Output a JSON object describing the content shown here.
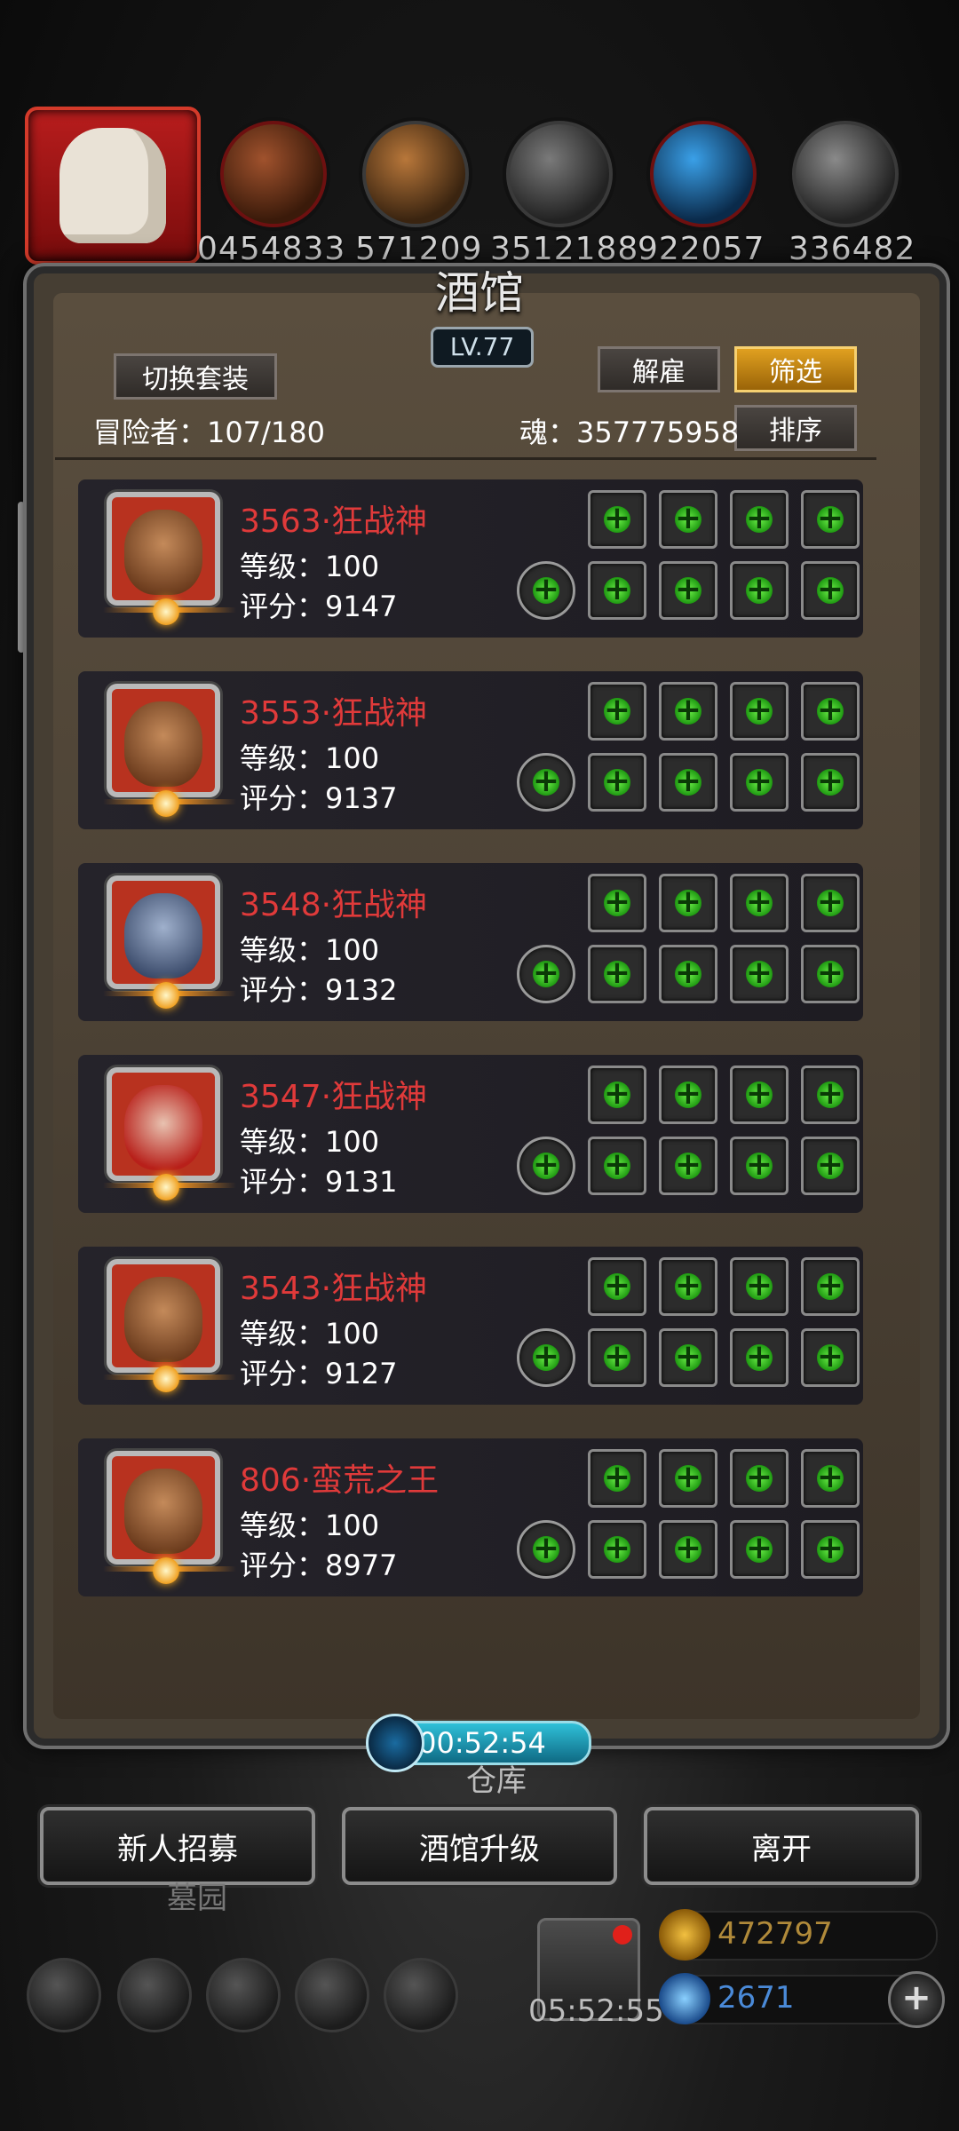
{
  "top_bar": {
    "resources": [
      "0454833",
      "571209",
      "3512188",
      "922057",
      "336482"
    ]
  },
  "tavern": {
    "title": "酒馆",
    "level": "LV.77",
    "switch_set_label": "切换套装",
    "dismiss_label": "解雇",
    "filter_label": "筛选",
    "sort_label": "排序",
    "adventurers_label": "冒险者：107/180",
    "soul_label": "魂：357775958"
  },
  "heroes": [
    {
      "name": "3563·狂战神",
      "level": "等级：100",
      "score": "评分：9147"
    },
    {
      "name": "3553·狂战神",
      "level": "等级：100",
      "score": "评分：9137"
    },
    {
      "name": "3548·狂战神",
      "level": "等级：100",
      "score": "评分：9132"
    },
    {
      "name": "3547·狂战神",
      "level": "等级：100",
      "score": "评分：9131"
    },
    {
      "name": "3543·狂战神",
      "level": "等级：100",
      "score": "评分：9127"
    },
    {
      "name": "806·蛮荒之王",
      "level": "等级：100",
      "score": "评分：8977"
    }
  ],
  "timer": "00:52:54",
  "background_labels": {
    "storage": "仓库",
    "graveyard": "墓园"
  },
  "actions": {
    "recruit": "新人招募",
    "upgrade": "酒馆升级",
    "leave": "离开"
  },
  "gift_timer": "05:52:55",
  "currency": {
    "gold": "472797",
    "gems": "2671"
  },
  "colors": {
    "accent_gold": "#e0a020",
    "hero_name_red": "#e03a3a",
    "timer_cyan": "#2fc0d8"
  }
}
